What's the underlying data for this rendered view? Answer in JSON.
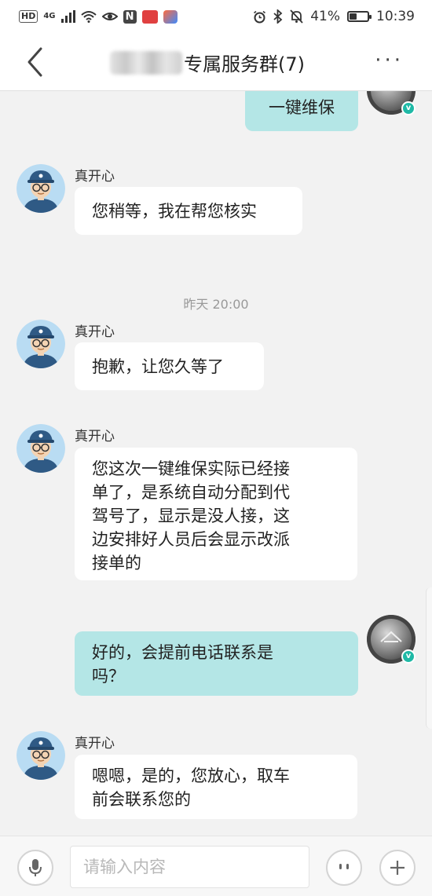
{
  "status_bar": {
    "hd_label": "HD",
    "network": "4G",
    "n_label": "N",
    "battery_percent_text": "41%",
    "battery_level": 0.41,
    "time": "10:39"
  },
  "header": {
    "title": "专属服务群(7)",
    "more": "···"
  },
  "messages": [
    {
      "side": "me",
      "text": "一键维保"
    },
    {
      "side": "other",
      "sender": "真开心",
      "text": "您稍等，我在帮您核实"
    },
    {
      "timestamp": "昨天 20:00"
    },
    {
      "side": "other",
      "sender": "真开心",
      "text": "抱歉，让您久等了"
    },
    {
      "side": "other",
      "sender": "真开心",
      "lines": [
        "您这次一键维保实际已经接",
        "单了，是系统自动分配到代",
        "驾号了，显示是没人接，这",
        "边安排好人员后会显示改派",
        "接单的"
      ]
    },
    {
      "side": "me",
      "lines": [
        "好的，会提前电话联系是",
        "吗？"
      ]
    },
    {
      "side": "other",
      "sender": "真开心",
      "lines": [
        "嗯嗯，是的，您放心，取车",
        "前会联系您的"
      ]
    }
  ],
  "input": {
    "placeholder": "请输入内容"
  },
  "colors": {
    "my_bubble": "#b4e6e6",
    "other_bubble": "#ffffff",
    "chat_background": "#f2f2f2",
    "verified_badge": "#1fb9a6"
  },
  "icons": [
    "back-arrow-icon",
    "more-icon",
    "alarm-icon",
    "bluetooth-icon",
    "mute-icon",
    "battery-icon",
    "microphone-icon",
    "emoji-icon",
    "plus-icon",
    "verified-icon"
  ]
}
